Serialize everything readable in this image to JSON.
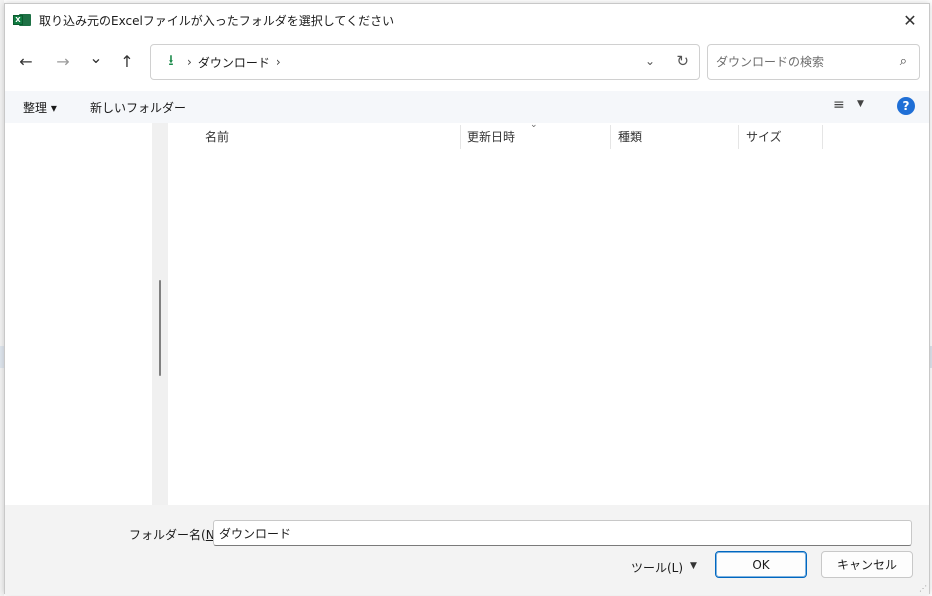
{
  "dialog": {
    "title": "取り込み元のExcelファイルが入ったフォルダを選択してください",
    "app_icon_letter": "X",
    "close_glyph": "✕"
  },
  "nav": {
    "back_glyph": "←",
    "forward_glyph": "→",
    "recent_glyph": "⌄",
    "up_glyph": "↑",
    "address": {
      "location_icon": "download-arrow-icon",
      "location_glyph": "⭳",
      "separator": "›",
      "segment": "ダウンロード",
      "dropdown_glyph": "⌄",
      "refresh_glyph": "↻"
    },
    "search": {
      "placeholder": "ダウンロードの検索",
      "icon_glyph": "⌕"
    }
  },
  "toolbar": {
    "organize_label": "整理 ▾",
    "new_folder_label": "新しいフォルダー",
    "view_glyph": "≡",
    "view_dd_glyph": "▼",
    "help_glyph": "?"
  },
  "filelist": {
    "sort_glyph": "⌄",
    "columns": [
      {
        "label": "名前"
      },
      {
        "label": "更新日時"
      },
      {
        "label": "種類"
      },
      {
        "label": "サイズ"
      }
    ]
  },
  "bottom": {
    "folder_name_label_prefix": "フォルダー名(",
    "folder_name_label_key": "N",
    "folder_name_label_suffix": "):",
    "folder_name_value": "ダウンロード",
    "tools_label": "ツール(L)",
    "tools_dd_glyph": "▼",
    "ok_label": "OK",
    "cancel_label": "キャンセル"
  },
  "colors": {
    "accent": "#0067c0",
    "excel_green": "#107c41",
    "download_green": "#1a8a4a",
    "help_blue": "#1f6fd6",
    "toolbar_bg": "#f5f7fa",
    "bottom_bg": "#f3f3f3"
  }
}
